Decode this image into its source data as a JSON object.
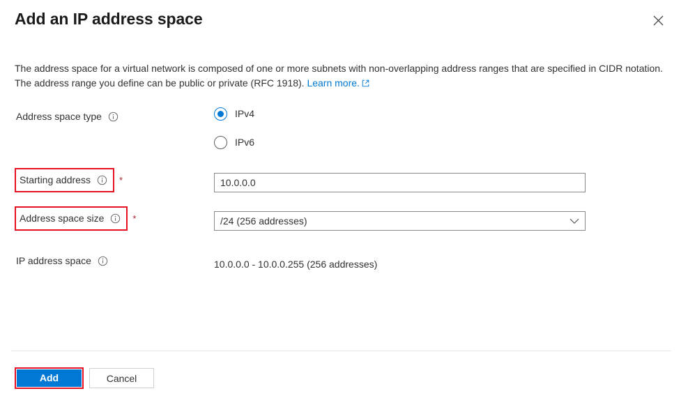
{
  "panel": {
    "title": "Add an IP address space",
    "close_icon": "close-icon"
  },
  "description": {
    "text_before_link": "The address space for a virtual network is composed of one or more subnets with non-overlapping address ranges that are specified in CIDR notation. The address range you define can be public or private (RFC 1918). ",
    "link_label": "Learn more.",
    "link_icon": "external-link-icon"
  },
  "form": {
    "address_space_type": {
      "label": "Address space type",
      "info_icon": "info-icon",
      "options": [
        {
          "label": "IPv4",
          "selected": true
        },
        {
          "label": "IPv6",
          "selected": false
        }
      ]
    },
    "starting_address": {
      "label": "Starting address",
      "info_icon": "info-icon",
      "required_marker": "*",
      "value": "10.0.0.0",
      "placeholder": "10.0.0.0",
      "highlighted": true
    },
    "address_space_size": {
      "label": "Address space size",
      "info_icon": "info-icon",
      "required_marker": "*",
      "selected_option": "/24 (256 addresses)",
      "chevron_icon": "chevron-down-icon",
      "highlighted": true
    },
    "ip_address_space": {
      "label": "IP address space",
      "info_icon": "info-icon",
      "value": "10.0.0.0 - 10.0.0.255 (256 addresses)"
    }
  },
  "footer": {
    "add_label": "Add",
    "cancel_label": "Cancel"
  },
  "colors": {
    "accent": "#0078d4",
    "highlight": "#e81123",
    "required": "#a4262c",
    "link": "#0078d4",
    "text": "#323130"
  }
}
